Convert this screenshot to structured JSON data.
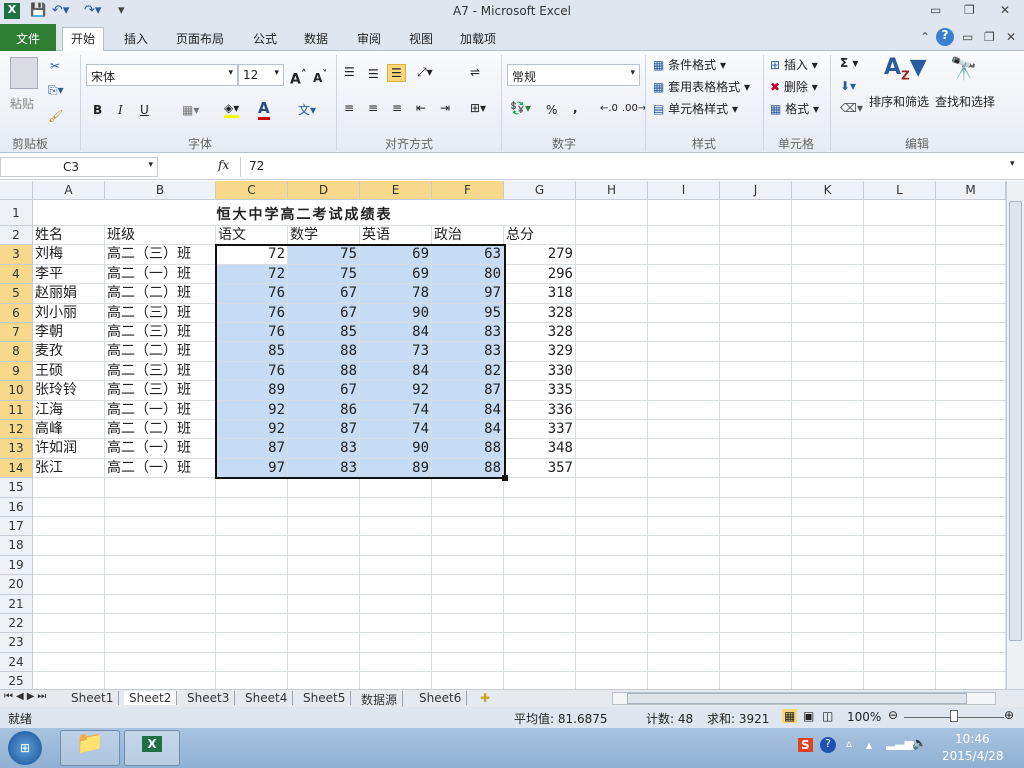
{
  "window": {
    "title": "A7  -  Microsoft Excel"
  },
  "tabs": [
    "文件",
    "开始",
    "插入",
    "页面布局",
    "公式",
    "数据",
    "审阅",
    "视图",
    "加载项"
  ],
  "ribbon": {
    "clipboard": {
      "paste": "粘贴",
      "label": "剪贴板"
    },
    "font": {
      "name": "宋体",
      "size": "12",
      "label": "字体",
      "bold": "B",
      "italic": "I",
      "underline": "U"
    },
    "alignment": {
      "label": "对齐方式"
    },
    "number": {
      "format": "常规",
      "label": "数字",
      "percent": "%",
      "comma": ","
    },
    "styles": {
      "conditional": "条件格式",
      "table": "套用表格格式",
      "cell": "单元格样式",
      "label": "样式"
    },
    "cells": {
      "insert": "插入",
      "delete": "删除",
      "format": "格式",
      "label": "单元格"
    },
    "editing": {
      "sort": "排序和筛选",
      "find": "查找和选择",
      "label": "编辑",
      "sum": "Σ"
    }
  },
  "formula_bar": {
    "name_box": "C3",
    "fx": "fx",
    "value": "72"
  },
  "columns": [
    "A",
    "B",
    "C",
    "D",
    "E",
    "F",
    "G",
    "H",
    "I",
    "J",
    "K",
    "L",
    "M"
  ],
  "sheet": {
    "title": "恒大中学高二考试成绩表",
    "headers": [
      "姓名",
      "班级",
      "语文",
      "数学",
      "英语",
      "政治",
      "总分"
    ],
    "rows": [
      [
        "刘梅",
        "高二（三）班",
        72,
        75,
        69,
        63,
        279
      ],
      [
        "李平",
        "高二（一）班",
        72,
        75,
        69,
        80,
        296
      ],
      [
        "赵丽娟",
        "高二（二）班",
        76,
        67,
        78,
        97,
        318
      ],
      [
        "刘小丽",
        "高二（三）班",
        76,
        67,
        90,
        95,
        328
      ],
      [
        "李朝",
        "高二（三）班",
        76,
        85,
        84,
        83,
        328
      ],
      [
        "麦孜",
        "高二（二）班",
        85,
        88,
        73,
        83,
        329
      ],
      [
        "王硕",
        "高二（三）班",
        76,
        88,
        84,
        82,
        330
      ],
      [
        "张玲铃",
        "高二（三）班",
        89,
        67,
        92,
        87,
        335
      ],
      [
        "江海",
        "高二（一）班",
        92,
        86,
        74,
        84,
        336
      ],
      [
        "高峰",
        "高二（二）班",
        92,
        87,
        74,
        84,
        337
      ],
      [
        "许如润",
        "高二（一）班",
        87,
        83,
        90,
        88,
        348
      ],
      [
        "张江",
        "高二（一）班",
        97,
        83,
        89,
        88,
        357
      ]
    ]
  },
  "sheet_tabs": [
    "Sheet1",
    "Sheet2",
    "Sheet3",
    "Sheet4",
    "Sheet5",
    "数据源",
    "Sheet6"
  ],
  "active_sheet": "Sheet2",
  "status": {
    "ready": "就绪",
    "average": "平均值: 81.6875",
    "count": "计数: 48",
    "sum": "求和: 3921",
    "zoom": "100%"
  },
  "clock": {
    "time": "10:46",
    "date": "2015/4/28"
  }
}
